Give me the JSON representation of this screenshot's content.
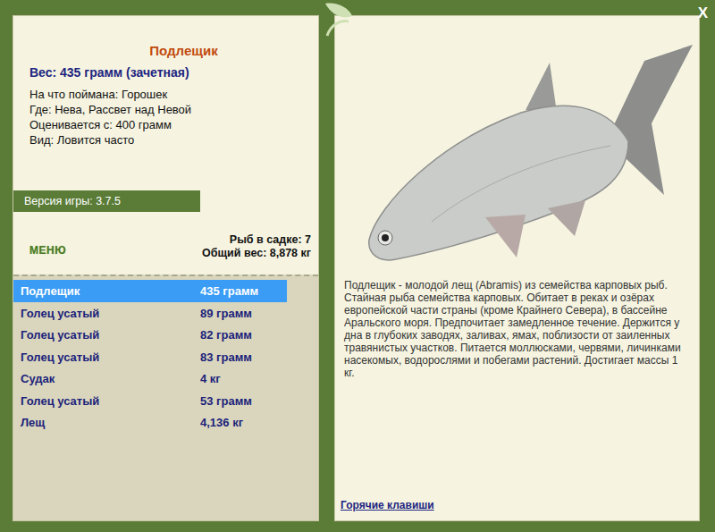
{
  "window": {
    "close": "X"
  },
  "fish": {
    "name": "Подлещик",
    "weight": "Вес: 435 грамм (зачетная)",
    "details": [
      "На что поймана: Горошек",
      "Где: Нева, Рассвет над Невой",
      "Оценивается с: 400 грамм",
      "Вид: Ловится часто"
    ],
    "description": "Подлещик - молодой лещ (Abramis) из семейства карповых рыб. Стайная рыба семейства карповых. Обитает в реках и озёрах европейской части страны (кроме Крайнего Севера), в бассейне Аральского моря. Предпочитает замедленное течение. Держится у дна в глубоких заводях, заливах, ямах, поблизости от заиленных травянистых участков. Питается моллюсками, червями, личинками насекомых, водорослями и побегами растений. Достигает массы 1 кг."
  },
  "version": "Версия игры: 3.7.5",
  "menu": "МЕНЮ",
  "keepnet": {
    "count": "Рыб в садке: 7",
    "total": "Общий вес: 8,878 кг"
  },
  "catch": [
    {
      "name": "Подлещик",
      "weight": "435 грамм",
      "selected": true
    },
    {
      "name": "Голец усатый",
      "weight": "89 грамм",
      "selected": false
    },
    {
      "name": "Голец усатый",
      "weight": "82 грамм",
      "selected": false
    },
    {
      "name": "Голец усатый",
      "weight": "83 грамм",
      "selected": false
    },
    {
      "name": "Судак",
      "weight": "4 кг",
      "selected": false
    },
    {
      "name": "Голец усатый",
      "weight": "53 грамм",
      "selected": false
    },
    {
      "name": "Лещ",
      "weight": "4,136 кг",
      "selected": false
    }
  ],
  "hotkeys": "Горячие клавиши"
}
